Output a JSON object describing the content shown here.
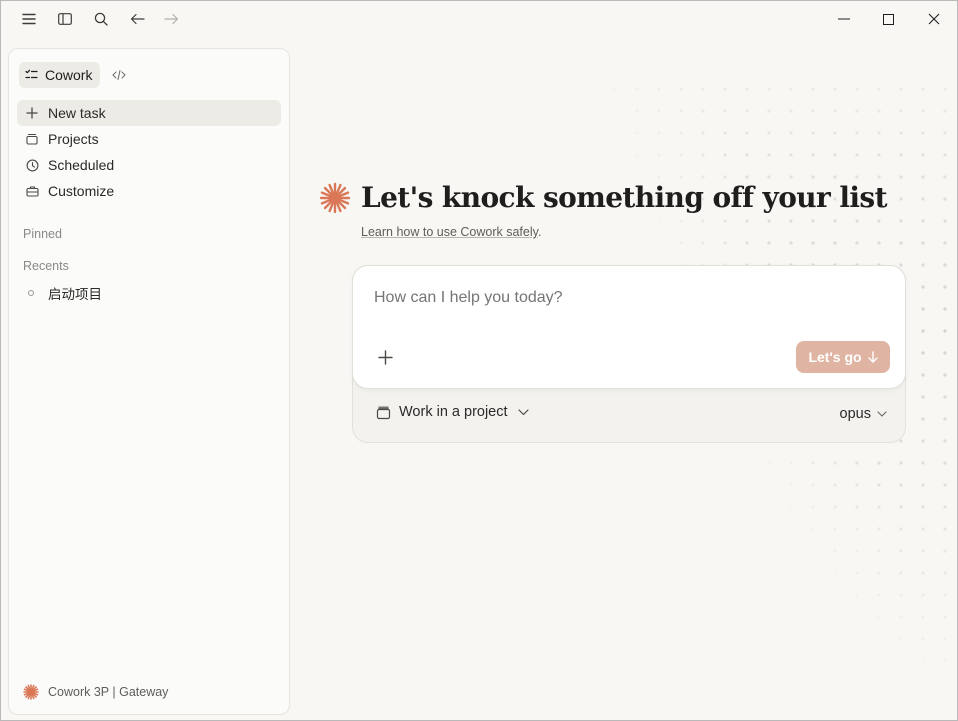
{
  "titlebar": {
    "icons": [
      "menu-icon",
      "sidebar-toggle-icon",
      "search-icon",
      "back-arrow-icon",
      "forward-arrow-icon"
    ],
    "window_controls": [
      "minimize-icon",
      "maximize-icon",
      "close-icon"
    ]
  },
  "sidebar": {
    "mode_label": "Cowork",
    "nav": [
      {
        "label": "New task",
        "icon": "plus-icon"
      },
      {
        "label": "Projects",
        "icon": "folder-icon"
      },
      {
        "label": "Scheduled",
        "icon": "clock-icon"
      },
      {
        "label": "Customize",
        "icon": "briefcase-icon"
      }
    ],
    "pinned_label": "Pinned",
    "recents_label": "Recents",
    "recents": [
      {
        "label": "启动项目"
      }
    ],
    "footer": "Cowork 3P | Gateway"
  },
  "main": {
    "heading": "Let's knock something off your list",
    "learn_link": "Learn how to use Cowork safely",
    "learn_suffix": ".",
    "prompt_placeholder": "How can I help you today?",
    "go_button": "Let's go",
    "project_label": "Work in a project",
    "model_label": "opus"
  },
  "colors": {
    "accent": "#d97757",
    "go_button": "#e0b4a2",
    "background": "#f8f7f4"
  }
}
